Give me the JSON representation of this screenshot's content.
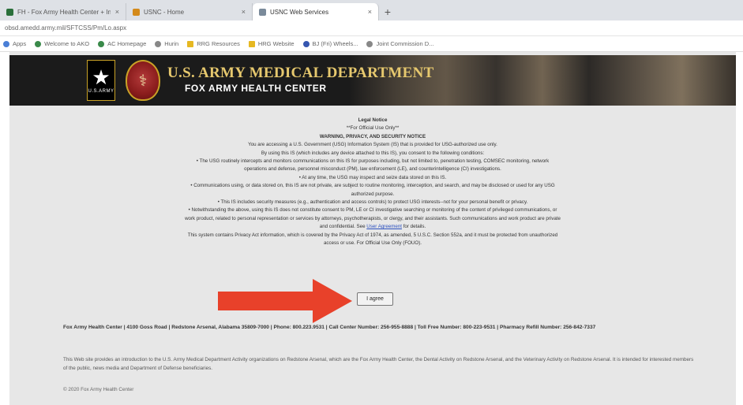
{
  "browser": {
    "tabs": [
      {
        "label": "FH - Fox Army Health Center + Internet",
        "icon": "fox-favicon-icon",
        "icon_color": "#2a6f3a",
        "active": false
      },
      {
        "label": "USNC - Home",
        "icon": "usnc-favicon-icon",
        "icon_color": "#d48a1a",
        "active": false
      },
      {
        "label": "USNC Web Services",
        "icon": "page-favicon-icon",
        "icon_color": "#7a8a9a",
        "active": true
      }
    ],
    "new_tab": "+",
    "close_glyph": "×",
    "url": "obsd.amedd.army.mil/SFTCSS/Pm/Lo.aspx",
    "bookmarks": [
      {
        "label": "Apps",
        "color": "#4a7fd6"
      },
      {
        "label": "Welcome to AKO",
        "color": "#3a8a4a"
      },
      {
        "label": "AC Homepage",
        "color": "#3a8a4a"
      },
      {
        "label": "Hurin",
        "color": "#888888"
      },
      {
        "label": "RRG Resources",
        "color": "#e6b822"
      },
      {
        "label": "HRG Website",
        "color": "#e6b822"
      },
      {
        "label": "BJ (Fri) Wheels...",
        "color": "#3556b0"
      },
      {
        "label": "Joint Commission D...",
        "color": "#888888"
      }
    ]
  },
  "banner": {
    "title": "U.S. ARMY MEDICAL DEPARTMENT",
    "subtitle": "FOX ARMY HEALTH CENTER",
    "army_badge_text": "U.S.ARMY"
  },
  "notice": {
    "lines": [
      "Legal Notice",
      "**For Official Use Only**",
      "WARNING, PRIVACY, AND SECURITY NOTICE",
      "You are accessing a U.S. Government (USG) Information System (IS) that is provided for USG-authorized use only.",
      "By using this IS (which includes any device attached to this IS), you consent to the following conditions:",
      "• The USG routinely intercepts and monitors communications on this IS for purposes including, but not limited to, penetration testing, COMSEC monitoring, network",
      "operations and defense, personnel misconduct (PM), law enforcement (LE), and counterintelligence (CI) investigations.",
      "• At any time, the USG may inspect and seize data stored on this IS.",
      "• Communications using, or data stored on, this IS are not private, are subject to routine monitoring, interception, and search, and may be disclosed or used for any USG",
      "authorized purpose.",
      "• This IS includes security measures (e.g., authentication and access controls) to protect USG interests--not for your personal benefit or privacy.",
      "• Notwithstanding the above, using this IS does not constitute consent to PM, LE or CI investigative searching or monitoring of the content of privileged communications, or",
      "work product, related to personal representation or services by attorneys, psychotherapists, or clergy, and their assistants. Such communications and work product are private"
    ],
    "confidential_prefix": "and confidential. See ",
    "user_agreement_link": "User Agreement",
    "confidential_suffix": " for details.",
    "privacy_line_1": "This system contains Privacy Act information, which is covered by the Privacy Act of 1974, as amended, 5 U.S.C. Section 552a, and it must be protected from unauthorized",
    "privacy_line_2": "access or use. For Official Use Only (FOUO)."
  },
  "agree_button": "I agree",
  "contact_text": "Fox Army Health Center | 4100 Goss Road | Redstone Arsenal, Alabama 35809-7000 | Phone: 800.223.9531 | Call Center Number: 256-955-8888 | Toll Free Number: 800-223-9531 | Pharmacy Refill Number: 256-842-7337",
  "intro_text": "This Web site provides an introduction to the U.S. Army Medical Department Activity organizations on Redstone Arsenal, which are the Fox Army Health Center, the Dental Activity on Redstone Arsenal, and the Veterinary Activity on Redstone Arsenal. It is intended for interested members of the public, news media and Department of Defense beneficiaries.",
  "copyright": "© 2020 Fox Army Health Center",
  "colors": {
    "arrow": "#e8412a",
    "banner_title": "#e6c86e",
    "link": "#2a4fbf"
  }
}
